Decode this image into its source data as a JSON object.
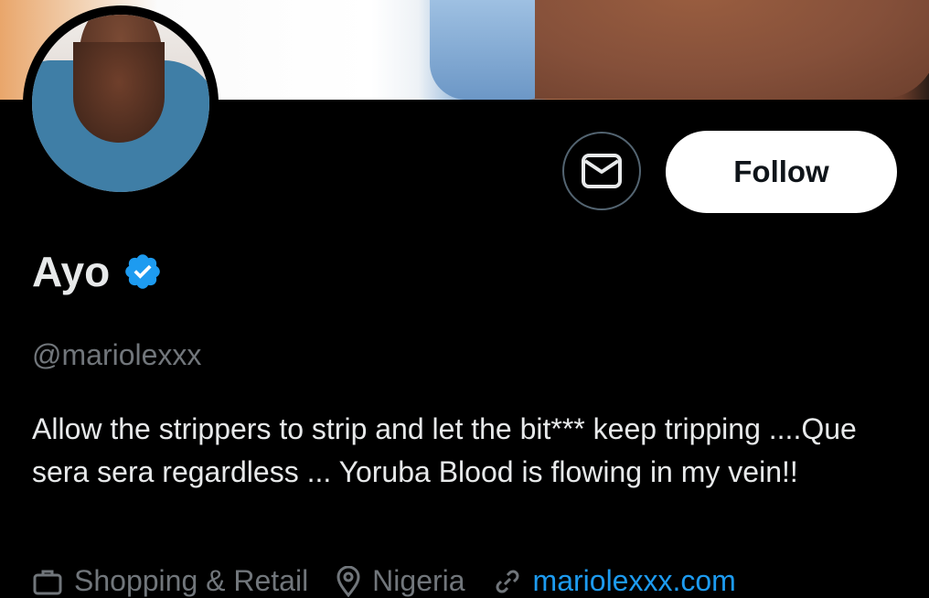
{
  "profile": {
    "name": "Ayo",
    "handle": "@mariolexxx",
    "verified": true,
    "bio": "Allow the strippers to strip and let the bit*** keep tripping ....Que sera sera regardless ... Yoruba Blood is flowing in my vein!!"
  },
  "actions": {
    "follow_label": "Follow",
    "message_icon": "envelope-icon"
  },
  "meta": {
    "category": "Shopping & Retail",
    "location": "Nigeria",
    "website": "mariolexxx.com"
  },
  "colors": {
    "background": "#000000",
    "text": "#e7e9ea",
    "muted": "#71767b",
    "link": "#1d9bf0",
    "verified": "#1d9bf0",
    "follow_bg": "#ffffff"
  }
}
